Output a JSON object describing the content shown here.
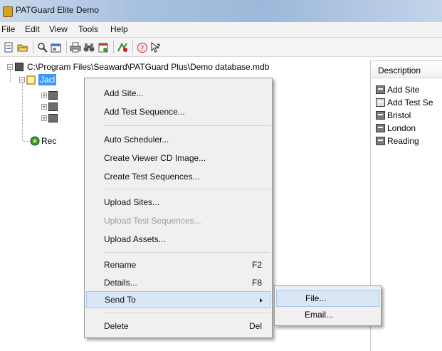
{
  "window": {
    "title": "PATGuard Elite Demo"
  },
  "menubar": {
    "items": [
      "File",
      "Edit",
      "View",
      "Tools",
      "Help"
    ]
  },
  "toolbar": {
    "icons": [
      "new-icon",
      "open-icon",
      "search-icon",
      "properties-icon",
      "print-icon",
      "binoculars-icon",
      "schedule-icon",
      "test-icon",
      "help-icon",
      "whats-this-icon"
    ]
  },
  "tree": {
    "root_path": "C:\\Program Files\\Seaward\\PATGuard Plus\\Demo database.mdb",
    "selected_label": "Jacl",
    "partial_child_label": "Rec"
  },
  "right_pane": {
    "column_header": "Description",
    "items": [
      "Add Site",
      "Add Test Se",
      "Bristol",
      "London",
      "Reading"
    ]
  },
  "context_menu": {
    "items": [
      {
        "label": "Add Site...",
        "shortcut": ""
      },
      {
        "label": "Add Test Sequence...",
        "shortcut": ""
      },
      {
        "label": "Auto Scheduler...",
        "shortcut": ""
      },
      {
        "label": "Create Viewer CD Image...",
        "shortcut": ""
      },
      {
        "label": "Create Test Sequences...",
        "shortcut": ""
      },
      {
        "label": "Upload Sites...",
        "shortcut": ""
      },
      {
        "label": "Upload Test Sequences...",
        "shortcut": "",
        "disabled": true
      },
      {
        "label": "Upload Assets...",
        "shortcut": ""
      },
      {
        "label": "Rename",
        "shortcut": "F2"
      },
      {
        "label": "Details...",
        "shortcut": "F8"
      },
      {
        "label": "Send To",
        "shortcut": "",
        "submenu": true
      },
      {
        "label": "Delete",
        "shortcut": "Del"
      }
    ]
  },
  "send_to_submenu": {
    "items": [
      {
        "label": "File..."
      },
      {
        "label": "Email..."
      }
    ]
  },
  "colors": {
    "selection": "#3399ff",
    "menu_highlight": "#d8e6f5",
    "menu_bg": "#f0f0f0"
  }
}
